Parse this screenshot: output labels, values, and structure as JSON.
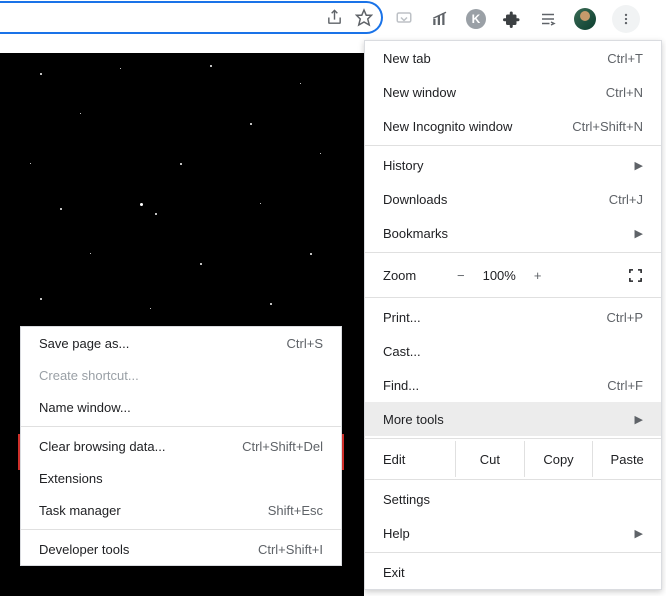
{
  "toolbar_icons": {
    "share": "share-icon",
    "star": "star-icon",
    "pocket": "pocket-icon",
    "analytics": "analytics-icon",
    "k_letter": "K",
    "extensions": "puzzle-icon",
    "reading": "reading-list-icon",
    "avatar": "profile-avatar",
    "menu": "dots-vertical-icon"
  },
  "menu": {
    "new_tab": {
      "label": "New tab",
      "shortcut": "Ctrl+T"
    },
    "new_window": {
      "label": "New window",
      "shortcut": "Ctrl+N"
    },
    "new_incognito": {
      "label": "New Incognito window",
      "shortcut": "Ctrl+Shift+N"
    },
    "history": {
      "label": "History"
    },
    "downloads": {
      "label": "Downloads",
      "shortcut": "Ctrl+J"
    },
    "bookmarks": {
      "label": "Bookmarks"
    },
    "zoom": {
      "label": "Zoom",
      "minus": "−",
      "value": "100%",
      "plus": "+"
    },
    "print": {
      "label": "Print...",
      "shortcut": "Ctrl+P"
    },
    "cast": {
      "label": "Cast..."
    },
    "find": {
      "label": "Find...",
      "shortcut": "Ctrl+F"
    },
    "more_tools": {
      "label": "More tools"
    },
    "edit": {
      "label": "Edit",
      "cut": "Cut",
      "copy": "Copy",
      "paste": "Paste"
    },
    "settings": {
      "label": "Settings"
    },
    "help": {
      "label": "Help"
    },
    "exit": {
      "label": "Exit"
    }
  },
  "submenu": {
    "save_page": {
      "label": "Save page as...",
      "shortcut": "Ctrl+S"
    },
    "create_shortcut": {
      "label": "Create shortcut..."
    },
    "name_window": {
      "label": "Name window..."
    },
    "clear_data": {
      "label": "Clear browsing data...",
      "shortcut": "Ctrl+Shift+Del"
    },
    "extensions": {
      "label": "Extensions"
    },
    "task_manager": {
      "label": "Task manager",
      "shortcut": "Shift+Esc"
    },
    "dev_tools": {
      "label": "Developer tools",
      "shortcut": "Ctrl+Shift+I"
    }
  }
}
